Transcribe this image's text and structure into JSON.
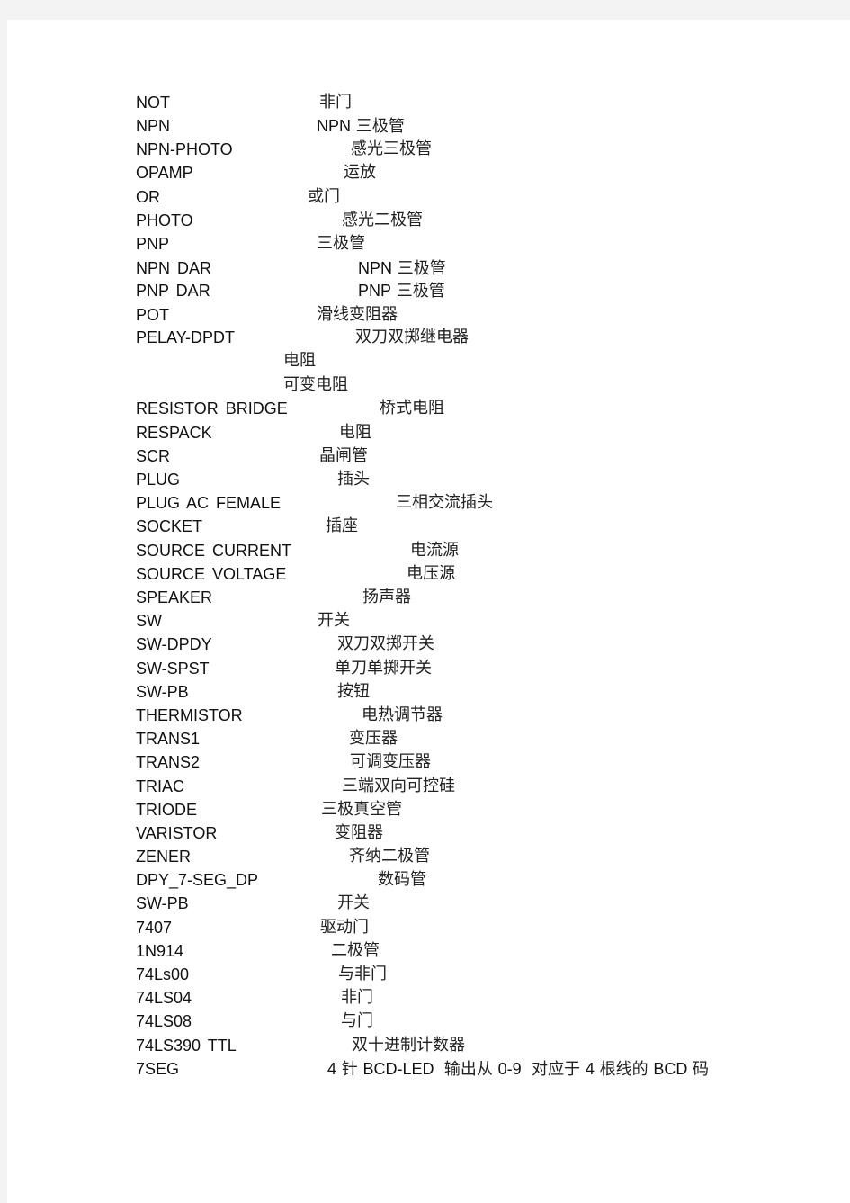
{
  "document": {
    "entries": [
      {
        "term": "NOT",
        "desc": "非门"
      },
      {
        "term": "NPN",
        "desc": "NPN 三极管"
      },
      {
        "term": "NPN-PHOTO",
        "desc": "感光三极管"
      },
      {
        "term": "OPAMP",
        "desc": "运放"
      },
      {
        "term": "OR",
        "desc": "或门"
      },
      {
        "term": "PHOTO",
        "desc": "感光二极管"
      },
      {
        "term": "PNP",
        "desc": "三极管"
      },
      {
        "term": "NPN DAR",
        "desc": "NPN 三极管"
      },
      {
        "term": "PNP DAR",
        "desc": "PNP 三极管"
      },
      {
        "term": "POT",
        "desc": "滑线变阻器"
      },
      {
        "term": "PELAY-DPDT",
        "desc": "双刀双掷继电器"
      },
      {
        "term": "",
        "desc": "电阻"
      },
      {
        "term": "",
        "desc": "可变电阻"
      },
      {
        "term": "RESISTOR BRIDGE",
        "desc": "桥式电阻"
      },
      {
        "term": "RESPACK",
        "desc": "电阻"
      },
      {
        "term": "SCR",
        "desc": "晶闸管"
      },
      {
        "term": "PLUG",
        "desc": "插头"
      },
      {
        "term": "PLUG AC FEMALE",
        "desc": "三相交流插头"
      },
      {
        "term": "SOCKET",
        "desc": "插座"
      },
      {
        "term": "SOURCE CURRENT",
        "desc": "电流源"
      },
      {
        "term": "SOURCE VOLTAGE",
        "desc": "电压源"
      },
      {
        "term": "SPEAKER",
        "desc": "扬声器"
      },
      {
        "term": "SW",
        "desc": "开关"
      },
      {
        "term": "SW-DPDY",
        "desc": "双刀双掷开关"
      },
      {
        "term": "SW-SPST",
        "desc": "单刀单掷开关"
      },
      {
        "term": "SW-PB",
        "desc": "按钮"
      },
      {
        "term": "THERMISTOR",
        "desc": "电热调节器"
      },
      {
        "term": "TRANS1",
        "desc": "变压器"
      },
      {
        "term": "TRANS2",
        "desc": "可调变压器"
      },
      {
        "term": "TRIAC",
        "desc": "三端双向可控硅"
      },
      {
        "term": "TRIODE",
        "desc": "三极真空管"
      },
      {
        "term": "VARISTOR",
        "desc": "变阻器"
      },
      {
        "term": "ZENER",
        "desc": "齐纳二极管"
      },
      {
        "term": "DPY_7-SEG_DP",
        "desc": "数码管"
      },
      {
        "term": "SW-PB",
        "desc": "开关"
      },
      {
        "term": "7407",
        "desc": "驱动门"
      },
      {
        "term": "1N914",
        "desc": "二极管"
      },
      {
        "term": "74Ls00",
        "desc": "与非门"
      },
      {
        "term": "74LS04",
        "desc": "非门"
      },
      {
        "term": "74LS08",
        "desc": "与门"
      },
      {
        "term": "74LS390 TTL",
        "desc": "双十进制计数器"
      },
      {
        "term": "7SEG",
        "desc": "4 针 BCD-LED  输出从 0-9  对应于 4 根线的 BCD 码"
      }
    ]
  }
}
